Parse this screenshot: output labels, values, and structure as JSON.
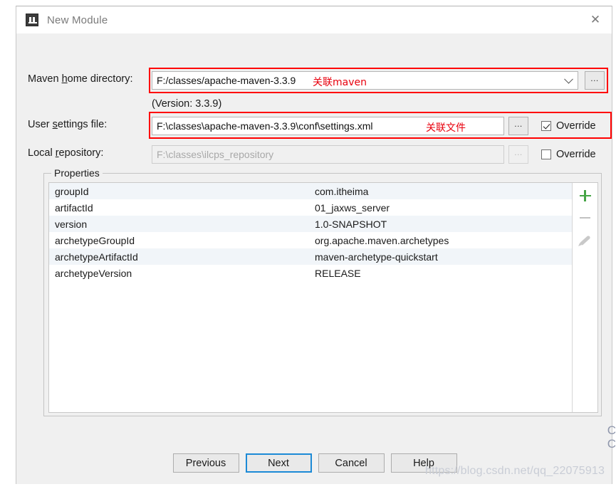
{
  "window": {
    "title": "New Module",
    "logo_icon": "intellij-idea-icon",
    "close_icon": "close-icon"
  },
  "fields": {
    "maven_home": {
      "label_before": "Maven ",
      "label_mnemonic": "h",
      "label_after": "ome directory:",
      "value": "F:/classes/apache-maven-3.3.9",
      "annotation": "关联maven",
      "version_note": "(Version: 3.3.9)",
      "browse_label": "...",
      "dropdown_icon": "chevron-down-icon"
    },
    "user_settings": {
      "label_before": "User ",
      "label_mnemonic": "s",
      "label_after": "ettings file:",
      "value": "F:\\classes\\apache-maven-3.3.9\\conf\\settings.xml",
      "annotation": "关联文件",
      "browse_label": "...",
      "override_label": "Override",
      "override_checked": true
    },
    "local_repository": {
      "label_before": "Local ",
      "label_mnemonic": "r",
      "label_after": "epository:",
      "value": "F:\\classes\\ilcps_repository",
      "browse_label": "...",
      "override_label": "Override",
      "override_checked": false
    }
  },
  "properties": {
    "group_title": "Properties",
    "rows": [
      {
        "key": "groupId",
        "value": "com.itheima"
      },
      {
        "key": "artifactId",
        "value": "01_jaxws_server"
      },
      {
        "key": "version",
        "value": "1.0-SNAPSHOT"
      },
      {
        "key": "archetypeGroupId",
        "value": "org.apache.maven.archetypes"
      },
      {
        "key": "archetypeArtifactId",
        "value": "maven-archetype-quickstart"
      },
      {
        "key": "archetypeVersion",
        "value": "RELEASE"
      }
    ],
    "toolbar": {
      "add_icon": "plus-icon",
      "remove_icon": "minus-icon",
      "edit_icon": "pencil-icon"
    }
  },
  "footer": {
    "previous": "Previous",
    "next": "Next",
    "cancel": "Cancel",
    "help": "Help"
  },
  "watermark": {
    "text": "https://blog.csdn.net/qq_22075913",
    "edge_glyphs": "C\nC"
  },
  "colors": {
    "annotation_red": "#e8000d",
    "highlight_box_red": "#ff0000",
    "focus_blue": "#1c8ad6",
    "add_green": "#46a546",
    "dialog_bg": "#f0f0f0",
    "row_alt": "#f1f5f9"
  }
}
